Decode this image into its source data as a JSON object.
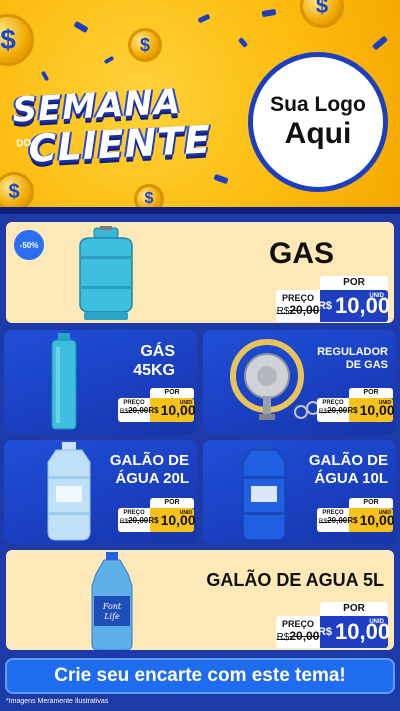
{
  "header": {
    "title_line1": "SEMANA",
    "title_do": "DO",
    "title_line2": "CLIENTE",
    "logo_line1": "Sua Logo",
    "logo_line2": "Aqui",
    "coin_symbol": "$",
    "colors": {
      "background": "#fcbc10",
      "accent": "#1b3fbf"
    }
  },
  "products": {
    "gas": {
      "title": "GAS",
      "badge": "-50%",
      "por": "POR",
      "preco": "PREÇO",
      "old_prefix": "R$",
      "old_price": "20,00",
      "currency": "R$",
      "price": "10,00",
      "unit": "UNID"
    },
    "gas45": {
      "title_l1": "GÁS",
      "title_l2": "45KG",
      "por": "POR",
      "preco": "PREÇO",
      "old_prefix": "R$",
      "old_price": "20,00",
      "currency": "R$",
      "price": "10,00",
      "unit": "UNID"
    },
    "regulador": {
      "title_l1": "REGULADOR",
      "title_l2": "DE GAS",
      "por": "POR",
      "preco": "PREÇO",
      "old_prefix": "R$",
      "old_price": "20,00",
      "currency": "R$",
      "price": "10,00",
      "unit": "UNID"
    },
    "galao20": {
      "title_l1": "GALÃO DE",
      "title_l2": "ÁGUA 20L",
      "por": "POR",
      "preco": "PREÇO",
      "old_prefix": "R$",
      "old_price": "20,00",
      "currency": "R$",
      "price": "10,00",
      "unit": "UNID"
    },
    "galao10": {
      "title_l1": "GALÃO DE",
      "title_l2": "ÁGUA 10L",
      "por": "POR",
      "preco": "PREÇO",
      "old_prefix": "R$",
      "old_price": "20,00",
      "currency": "R$",
      "price": "10,00",
      "unit": "UNID"
    },
    "galao5": {
      "title": "GALÃO DE AGUA 5L",
      "bottle_label_l1": "Font",
      "bottle_label_l2": "Life",
      "por": "POR",
      "preco": "PREÇO",
      "old_prefix": "R$",
      "old_price": "20,00",
      "currency": "R$",
      "price": "10,00",
      "unit": "UNID"
    }
  },
  "footer": {
    "cta": "Crie seu encarte com este tema!",
    "disclaimer": "*Imagens Meramente Ilustrativas"
  }
}
